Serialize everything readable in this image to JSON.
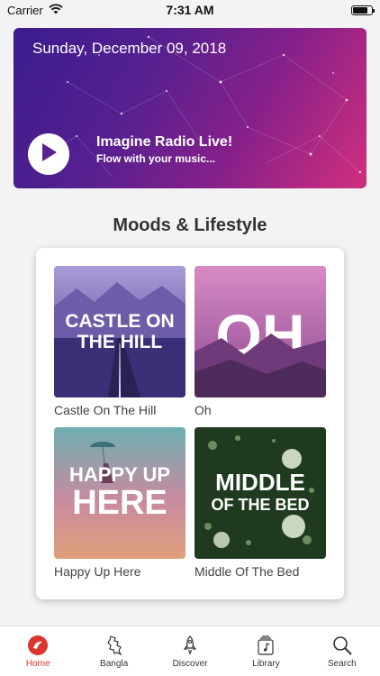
{
  "status_bar": {
    "carrier": "Carrier",
    "time": "7:31 AM",
    "battery_level": 0.8
  },
  "banner": {
    "date": "Sunday, December 09, 2018",
    "title": "Imagine Radio Live!",
    "subtitle": "Flow with your music..."
  },
  "section": {
    "title": "Moods & Lifestyle"
  },
  "playlists": [
    {
      "title": "Castle On The Hill",
      "art_text": [
        "CASTLE ON",
        "THE HILL"
      ]
    },
    {
      "title": "Oh",
      "art_text": [
        "OH"
      ]
    },
    {
      "title": "Happy Up Here",
      "art_text": [
        "HAPPY UP",
        "HERE"
      ]
    },
    {
      "title": "Middle Of The Bed",
      "art_text": [
        "MIDDLE",
        "OF THE BED"
      ]
    }
  ],
  "tabs": [
    {
      "label": "Home",
      "icon": "home-icon",
      "active": true
    },
    {
      "label": "Bangla",
      "icon": "bangladesh-map-icon"
    },
    {
      "label": "Discover",
      "icon": "rocket-icon"
    },
    {
      "label": "Library",
      "icon": "music-library-icon"
    },
    {
      "label": "Search",
      "icon": "search-icon"
    }
  ],
  "colors": {
    "accent": "#d9362f",
    "banner_start": "#3b1c8e",
    "banner_end": "#d12f7d"
  }
}
